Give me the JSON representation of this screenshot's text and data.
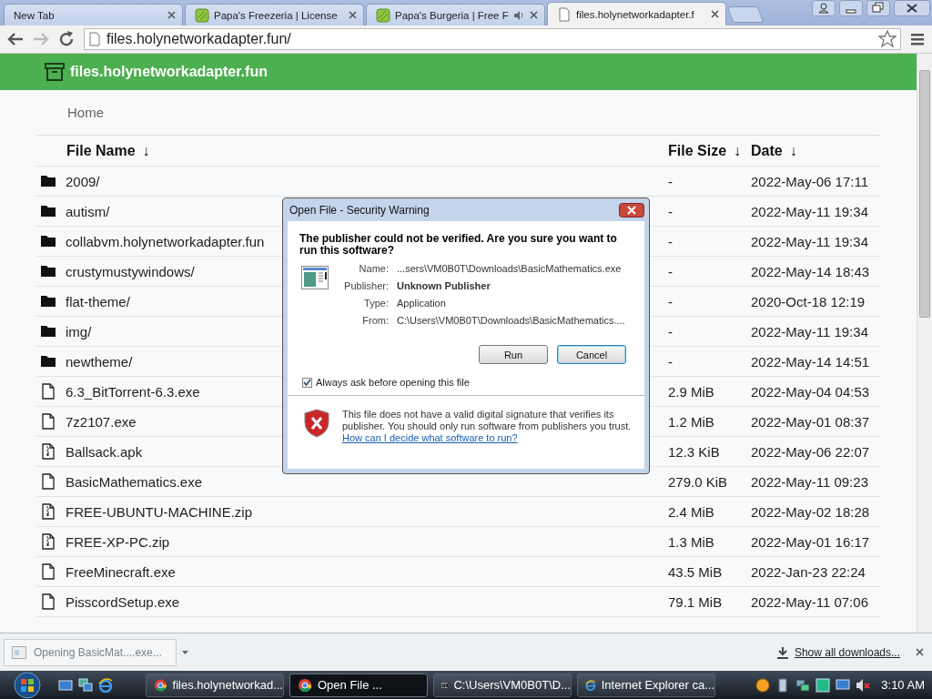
{
  "browser": {
    "tabs": [
      {
        "title": "New Tab",
        "kind": "blank",
        "audio": false,
        "selected": false
      },
      {
        "title": "Papa's Freezeria | License",
        "kind": "game",
        "audio": false,
        "selected": false
      },
      {
        "title": "Papa's Burgeria | Free F",
        "kind": "game",
        "audio": true,
        "selected": false
      },
      {
        "title": "files.holynetworkadapter.f",
        "kind": "page",
        "audio": false,
        "selected": true
      }
    ],
    "address": "files.holynetworkadapter.fun/"
  },
  "site": {
    "title": "files.holynetworkadapter.fun",
    "breadcrumb": "Home",
    "columns": [
      {
        "label": "File Name",
        "sort_mark": "↓"
      },
      {
        "label": "File Size",
        "sort_mark": "↓"
      },
      {
        "label": "Date",
        "sort_mark": "↓"
      }
    ],
    "rows": [
      {
        "kind": "folder",
        "name": "2009/",
        "size": "-",
        "date": "2022-May-06 17:11"
      },
      {
        "kind": "folder",
        "name": "autism/",
        "size": "-",
        "date": "2022-May-11 19:34"
      },
      {
        "kind": "folder",
        "name": "collabvm.holynetworkadapter.fun",
        "size": "-",
        "date": "2022-May-11 19:34"
      },
      {
        "kind": "folder",
        "name": "crustymustywindows/",
        "size": "-",
        "date": "2022-May-14 18:43"
      },
      {
        "kind": "folder",
        "name": "flat-theme/",
        "size": "-",
        "date": "2020-Oct-18 12:19"
      },
      {
        "kind": "folder",
        "name": "img/",
        "size": "-",
        "date": "2022-May-11 19:34"
      },
      {
        "kind": "folder",
        "name": "newtheme/",
        "size": "-",
        "date": "2022-May-14 14:51"
      },
      {
        "kind": "file",
        "name": "6.3_BitTorrent-6.3.exe",
        "size": "2.9 MiB",
        "date": "2022-May-04 04:53"
      },
      {
        "kind": "file",
        "name": "7z2107.exe",
        "size": "1.2 MiB",
        "date": "2022-May-01 08:37"
      },
      {
        "kind": "archive",
        "name": "Ballsack.apk",
        "size": "12.3 KiB",
        "date": "2022-May-06 22:07"
      },
      {
        "kind": "file",
        "name": "BasicMathematics.exe",
        "size": "279.0 KiB",
        "date": "2022-May-11 09:23"
      },
      {
        "kind": "archive",
        "name": "FREE-UBUNTU-MACHINE.zip",
        "size": "2.4 MiB",
        "date": "2022-May-02 18:28"
      },
      {
        "kind": "archive",
        "name": "FREE-XP-PC.zip",
        "size": "1.3 MiB",
        "date": "2022-May-01 16:17"
      },
      {
        "kind": "file",
        "name": "FreeMinecraft.exe",
        "size": "43.5 MiB",
        "date": "2022-Jan-23 22:24"
      },
      {
        "kind": "file",
        "name": "PisscordSetup.exe",
        "size": "79.1 MiB",
        "date": "2022-May-11 07:06"
      }
    ]
  },
  "dialog": {
    "title": "Open File - Security Warning",
    "heading": "The publisher could not be verified.  Are you sure you want to run this software?",
    "fields": [
      {
        "label": "Name:",
        "value": "...sers\\VM0B0T\\Downloads\\BasicMathematics.exe",
        "emphasis": false
      },
      {
        "label": "Publisher:",
        "value": "Unknown Publisher",
        "emphasis": true
      },
      {
        "label": "Type:",
        "value": "Application",
        "emphasis": false
      },
      {
        "label": "From:",
        "value": "C:\\Users\\VM0B0T\\Downloads\\BasicMathematics....",
        "emphasis": false
      }
    ],
    "buttons": [
      {
        "label": "Run",
        "default": false
      },
      {
        "label": "Cancel",
        "default": true
      }
    ],
    "checkbox": {
      "label": "Always ask before opening this file",
      "checked": true
    },
    "warning": "This file does not have a valid digital signature that verifies its publisher.  You should only run software from publishers you trust.",
    "link": "How can I decide what software to run?"
  },
  "downloads": {
    "item": "Opening BasicMat....exe...",
    "show_all": "Show all downloads..."
  },
  "taskbar": {
    "tasks": [
      {
        "label": "files.holynetworkad...",
        "kind": "chrome",
        "selected": false
      },
      {
        "label": "Open File ...",
        "kind": "chrome",
        "selected": true
      },
      {
        "label": "C:\\Users\\VM0B0T\\D...",
        "kind": "archiver",
        "selected": false
      },
      {
        "label": "Internet Explorer ca...",
        "kind": "explorer",
        "selected": false
      }
    ],
    "clock": "3:10 AM"
  }
}
